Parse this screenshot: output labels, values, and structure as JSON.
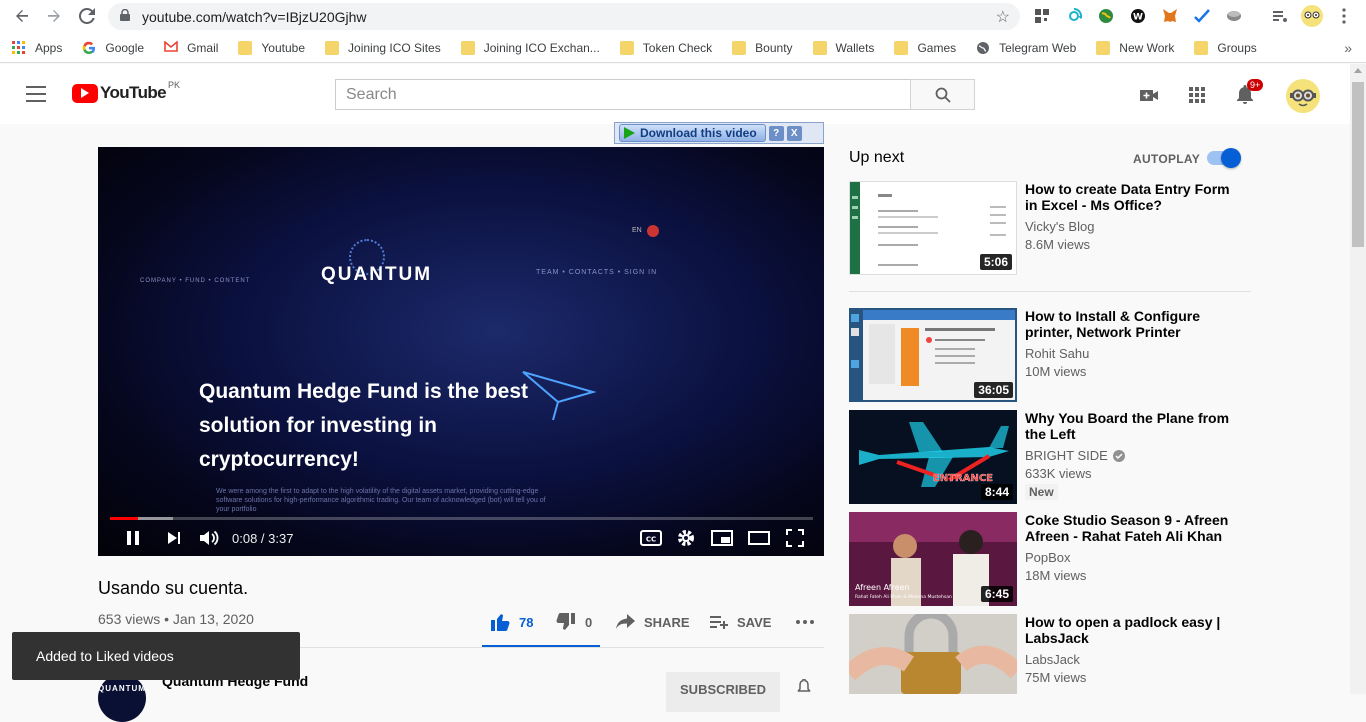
{
  "browser": {
    "url": "youtube.com/watch?v=IBjzU20Gjhw",
    "bookmarks": [
      {
        "label": "Apps",
        "type": "apps"
      },
      {
        "label": "Google",
        "type": "google"
      },
      {
        "label": "Gmail",
        "type": "gmail"
      },
      {
        "label": "Youtube",
        "type": "folder"
      },
      {
        "label": "Joining ICO Sites",
        "type": "folder"
      },
      {
        "label": "Joining ICO Exchan...",
        "type": "folder"
      },
      {
        "label": "Token Check",
        "type": "folder"
      },
      {
        "label": "Bounty",
        "type": "folder"
      },
      {
        "label": "Wallets",
        "type": "folder"
      },
      {
        "label": "Games",
        "type": "folder"
      },
      {
        "label": "Telegram Web",
        "type": "globe"
      },
      {
        "label": "New Work",
        "type": "folder"
      },
      {
        "label": "Groups",
        "type": "folder"
      }
    ]
  },
  "header": {
    "logo_text": "YouTube",
    "country_code": "PK",
    "search_placeholder": "Search",
    "notification_count": "9+"
  },
  "downloader": {
    "label": "Download this video",
    "help": "?",
    "close": "X"
  },
  "player": {
    "brand": "QUANTUM",
    "nav_left": "COMPANY • FUND • CONTENT",
    "nav_right": "TEAM • CONTACTS • SIGN IN",
    "lang": "EN",
    "headline": "Quantum Hedge Fund is the best solution for investing in cryptocurrency!",
    "paragraph": "We were among the first to adapt to the high volatility of the digital assets market, providing cutting-edge software solutions for high-performance algorithmic trading. Our team of acknowledged (bot) will tell you of your portfolio",
    "time_current": "0:08",
    "time_total": "3:37",
    "time_display": "0:08 / 3:37",
    "progress_played": 0.04,
    "progress_buffered": 0.09
  },
  "video": {
    "title": "Usando su cuenta.",
    "meta": "653 views • Jan 13, 2020",
    "likes": "78",
    "dislikes": "0",
    "share_label": "SHARE",
    "save_label": "SAVE",
    "channel_name": "Quantum Hedge Fund",
    "channel_avatar_text": "QUANTUM",
    "subscribed_label": "SUBSCRIBED"
  },
  "toast": {
    "message": "Added to Liked videos"
  },
  "sidebar": {
    "up_next": "Up next",
    "autoplay": "AUTOPLAY",
    "autoplay_on": true,
    "items": [
      {
        "title": "How to create Data Entry Form in Excel - Ms Office?",
        "channel": "Vicky's Blog",
        "views": "8.6M views",
        "duration": "5:06",
        "verified": false,
        "badge": ""
      },
      {
        "title": "How to Install & Configure printer, Network Printer",
        "channel": "Rohit Sahu",
        "views": "10M views",
        "duration": "36:05",
        "verified": false,
        "badge": ""
      },
      {
        "title": "Why You Board the Plane from the Left",
        "channel": "BRIGHT SIDE",
        "views": "633K views",
        "duration": "8:44",
        "verified": true,
        "badge": "New"
      },
      {
        "title": "Coke Studio Season 9 - Afreen Afreen - Rahat Fateh Ali Khan ...",
        "channel": "PopBox",
        "views": "18M views",
        "duration": "6:45",
        "verified": false,
        "badge": ""
      },
      {
        "title": "How to open a padlock easy | LabsJack",
        "channel": "LabsJack",
        "views": "75M views",
        "duration": "",
        "verified": false,
        "badge": ""
      }
    ]
  },
  "thumb_text": {
    "entrance": "ENTRANCE",
    "afreen": "Afreen Afreen",
    "afreen_sub": "Rahat Fateh Ali Khan & Momina Mustehsan"
  },
  "colors": {
    "youtube_red": "#ff0000",
    "like_blue": "#065fd4",
    "toast_bg": "#323232"
  }
}
